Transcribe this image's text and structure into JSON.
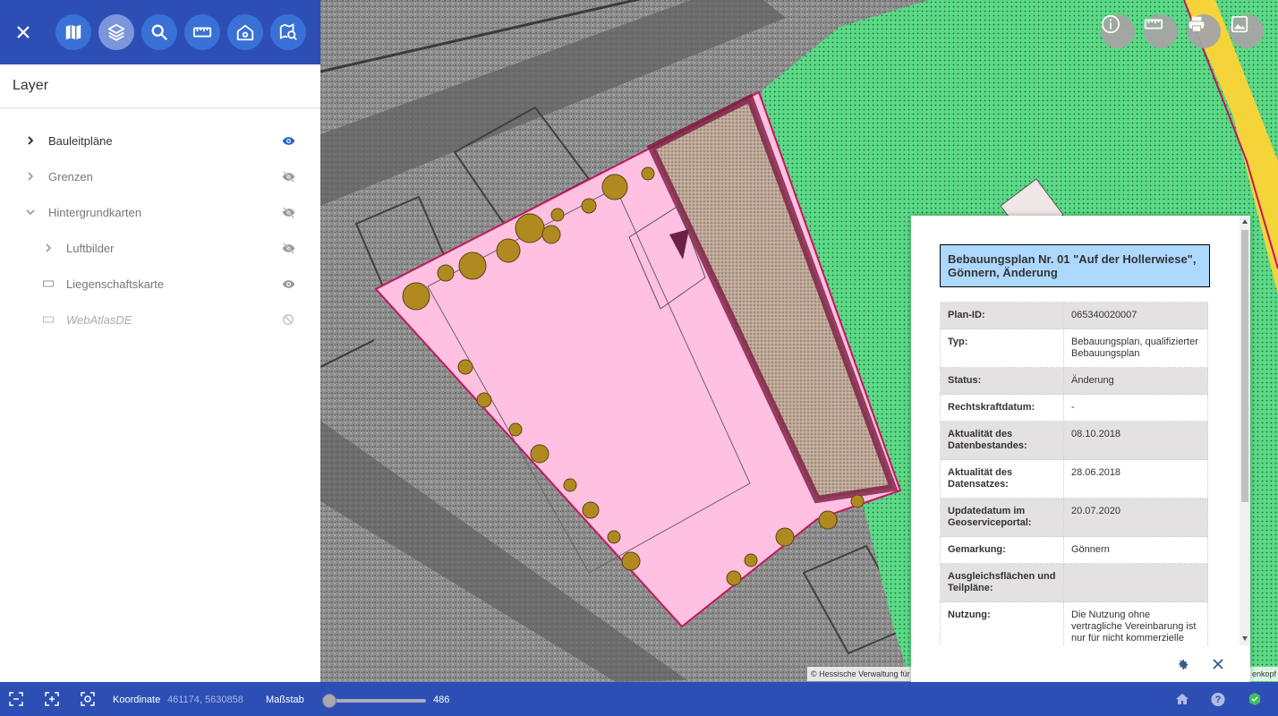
{
  "toolbar": {
    "buttons": [
      "close",
      "map",
      "layers",
      "search",
      "measure",
      "building-search",
      "map-search"
    ],
    "active": "layers"
  },
  "layer_panel": {
    "title": "Layer",
    "items": [
      {
        "label": "Bauleitpläne",
        "state": "visible"
      },
      {
        "label": "Grenzen",
        "state": "hidden"
      },
      {
        "label": "Hintergrundkarten",
        "state": "hidden"
      },
      {
        "label": "Luftbilder",
        "state": "hidden"
      },
      {
        "label": "Liegenschaftskarte",
        "state": "visible"
      },
      {
        "label": "WebAtlasDE",
        "state": "disabled"
      }
    ]
  },
  "map_controls": [
    "info",
    "measure",
    "print",
    "image"
  ],
  "popup": {
    "title": "Bebauungsplan Nr. 01 \"Auf der Hollerwiese\", Gönnern, Änderung",
    "rows": [
      {
        "key": "Plan-ID:",
        "value": "065340020007"
      },
      {
        "key": "Typ:",
        "value": "Bebauungsplan, qualifizierter Bebauungsplan"
      },
      {
        "key": "Status:",
        "value": "Änderung"
      },
      {
        "key": "Rechtskraftdatum:",
        "value": "-"
      },
      {
        "key": "Aktualität des Datenbestandes:",
        "value": "08.10.2018"
      },
      {
        "key": "Aktualität des Datensatzes:",
        "value": "28.06.2018"
      },
      {
        "key": "Updatedatum im Geoserviceportal:",
        "value": "20.07.2020"
      },
      {
        "key": "Gemarkung:",
        "value": "Gönnern"
      },
      {
        "key": "Ausgleichsflächen und Teilpläne:",
        "value": ""
      },
      {
        "key": "Nutzung:",
        "value": "Die Nutzung ohne vertragliche Vereinbarung ist nur für nicht kommerzielle"
      }
    ]
  },
  "attribution": {
    "left": "© Hessische Verwaltung für",
    "right": "enkopf"
  },
  "footer": {
    "coord_label": "Koordinate",
    "coord_value": "461174, 5630858",
    "scale_label": "Maßstab",
    "scale_value": "486",
    "scale_position": 0.03
  },
  "colors": {
    "header_blue": "#2d4fb5",
    "button_blue": "#3a71d6",
    "plan_pink": "#ffc0e2",
    "green_area": "#5cd987",
    "popup_title_bg": "#add8ff"
  }
}
